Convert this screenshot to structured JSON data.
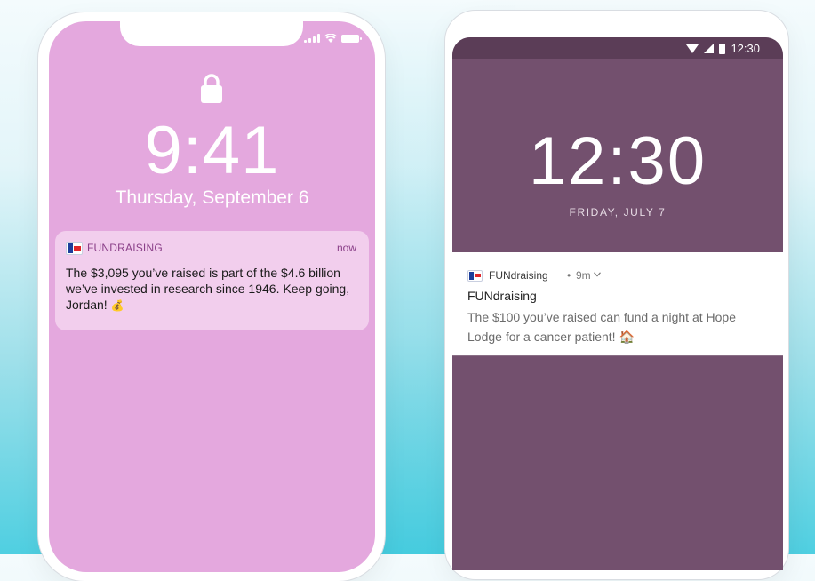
{
  "ios": {
    "time": "9:41",
    "date": "Thursday, September 6",
    "notification": {
      "app_name": "FUNDRAISING",
      "time": "now",
      "body": "The $3,095 you’ve raised is part of the $4.6 billion we’ve invested in research since 1946. Keep going, Jordan!",
      "emoji": "💰"
    },
    "icons": {
      "lock": "lock-icon",
      "signal": "signal-icon",
      "wifi": "wifi-icon",
      "battery": "battery-icon"
    }
  },
  "android": {
    "status_time": "12:30",
    "time": "12:30",
    "date": "FRIDAY, JULY 7",
    "notification": {
      "app_name": "FUNdraising",
      "separator": "•",
      "time": "9m",
      "title": "FUNdraising",
      "body": "The $100 you’ve raised can fund a night at Hope Lodge for a cancer patient!",
      "emoji": "🏠"
    },
    "icons": {
      "wifi": "wifi-icon",
      "cell": "cell-signal-icon",
      "battery": "battery-icon",
      "expand": "chevron-down-icon"
    }
  },
  "colors": {
    "ios_screen": "#e4a8de",
    "android_screen": "#73506e",
    "android_status_bar": "#5b3d57",
    "notif_accent": "#8a3f88"
  }
}
